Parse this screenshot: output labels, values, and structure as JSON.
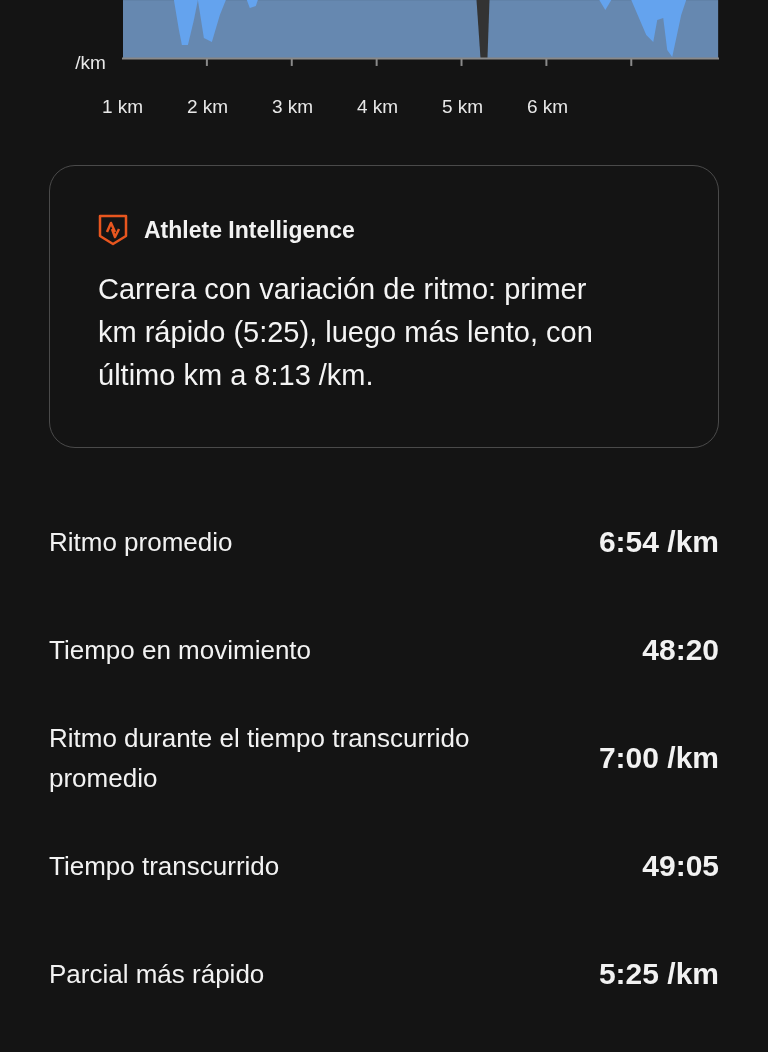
{
  "pace_chart": {
    "y_unit": "/km",
    "x_labels": [
      "1 km",
      "2 km",
      "3 km",
      "4 km",
      "5 km",
      "6 km"
    ]
  },
  "insight_card": {
    "title": "Athlete Intelligence",
    "text": "Carrera con variación de ritmo: primer km rápido (5:25), luego más lento, con último km a 8:13 /km."
  },
  "stats": [
    {
      "label": "Ritmo promedio",
      "value": "6:54 /km"
    },
    {
      "label": "Tiempo en movimiento",
      "value": "48:20"
    },
    {
      "label": "Ritmo durante el tiempo transcurrido promedio",
      "value": "7:00 /km"
    },
    {
      "label": "Tiempo transcurrido",
      "value": "49:05"
    },
    {
      "label": "Parcial más rápido",
      "value": "5:25 /km"
    }
  ]
}
